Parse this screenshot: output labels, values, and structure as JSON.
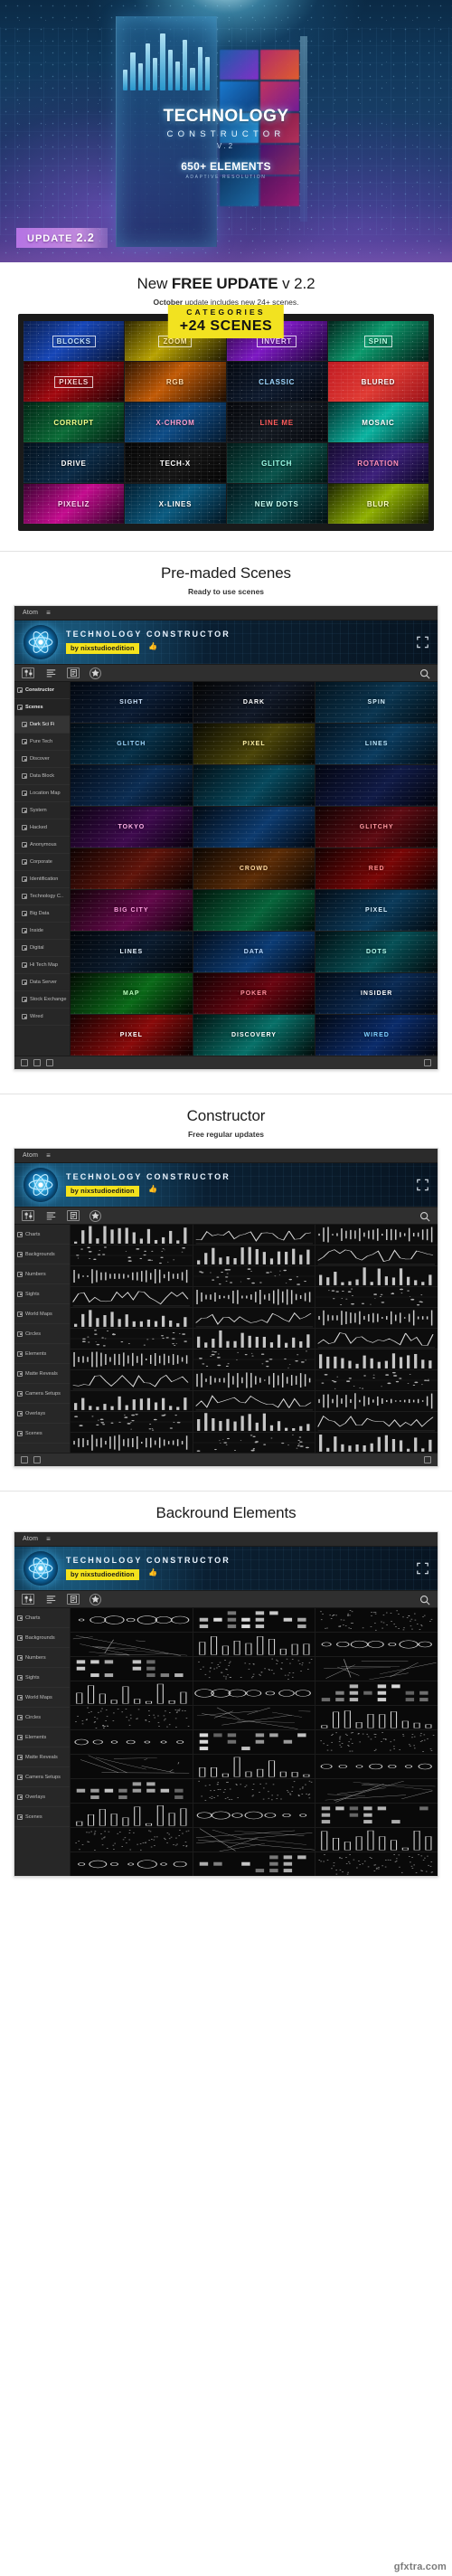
{
  "hero": {
    "title_main": "TECHNOLOGY",
    "title_sub": "CONSTRUCTOR",
    "title_version": "V.2",
    "elements_count": "650+ ELEMENTS",
    "adaptive_note": "ADAPTIVE RESOLUTION",
    "badge_prefix": "UPDATE",
    "badge_version": "2.2"
  },
  "update_section": {
    "heading_pre": "New ",
    "heading_bold": "FREE UPDATE",
    "heading_post": " v 2.2",
    "sub_bold": "October",
    "sub_rest": " update includes new 24+ scenes.",
    "categories_label": "CATEGORIES",
    "scenes_label": "+24 SCENES",
    "cells": [
      {
        "label": "BLOCKS",
        "boxed": true,
        "bg": "linear-gradient(135deg,#0a1c4a,#1646b8 45%,#06102e)",
        "c": "#bfe0ff"
      },
      {
        "label": "ZOOM",
        "boxed": true,
        "bg": "linear-gradient(135deg,#2b2400,#b8a200 45%,#1a1500)",
        "c": "#ffe9a0"
      },
      {
        "label": "INVERT",
        "boxed": true,
        "bg": "linear-gradient(135deg,#2a0740,#7d18c4 45%,#16032a)",
        "c": "#e9c6ff"
      },
      {
        "label": "SPIN",
        "boxed": true,
        "bg": "linear-gradient(135deg,#02241c,#0a9a6c 45%,#021a14)",
        "c": "#b5ffe2"
      },
      {
        "label": "PIXELS",
        "boxed": true,
        "bg": "linear-gradient(135deg,#2a0206,#a3080f 45%,#1a0104)",
        "c": "#ffd2d2"
      },
      {
        "label": "RGB",
        "boxed": false,
        "bg": "linear-gradient(135deg,#2b1300,#c25a05 45%,#1a0b00)",
        "c": "#ffd9a8"
      },
      {
        "label": "CLASSIC",
        "boxed": false,
        "bg": "linear-gradient(135deg,#04080f,#0e1a2e 50%,#03060c)",
        "c": "#9fd8ff"
      },
      {
        "label": "BLURED",
        "boxed": false,
        "bg": "linear-gradient(135deg,#c01a22,#e03a33 50%,#9a1118)",
        "c": "#ffffff"
      },
      {
        "label": "CORRUPT",
        "boxed": false,
        "bg": "linear-gradient(135deg,#012414,#0a6b36 50%,#01190e)",
        "c": "#f4ff8a"
      },
      {
        "label": "X-CHROM",
        "boxed": false,
        "bg": "linear-gradient(135deg,#062039,#0d4b86 50%,#03162a)",
        "c": "#ff9fd0"
      },
      {
        "label": "LINE ME",
        "boxed": false,
        "bg": "linear-gradient(135deg,#05060a,#121820 50%,#04050a)",
        "c": "#ff5c5c"
      },
      {
        "label": "MOSAIC",
        "boxed": false,
        "bg": "linear-gradient(135deg,#01302c,#0ab3a0 50%,#012320)",
        "c": "#ffffff"
      },
      {
        "label": "DRIVE",
        "boxed": false,
        "bg": "linear-gradient(135deg,#03101c,#0a2a46 55%,#020a13)",
        "c": "#ffffff"
      },
      {
        "label": "TECH-X",
        "boxed": false,
        "bg": "linear-gradient(135deg,#050505,#141414 55%,#030303)",
        "c": "#ffffff"
      },
      {
        "label": "GLITCH",
        "boxed": false,
        "bg": "linear-gradient(135deg,#021a18,#08524a 55%,#011210)",
        "c": "#9dffe9"
      },
      {
        "label": "ROTATION",
        "boxed": false,
        "bg": "linear-gradient(135deg,#140a2e,#3b1f7a 55%,#0a0520)",
        "c": "#ff8fb8"
      },
      {
        "label": "PIXELIZ",
        "boxed": false,
        "bg": "linear-gradient(135deg,#3a0230,#c40b8e 50%,#26011f)",
        "c": "#ffd6f2"
      },
      {
        "label": "X-LINES",
        "boxed": false,
        "bg": "linear-gradient(135deg,#021c2e,#0a5a80 50%,#01121e)",
        "c": "#ffffff"
      },
      {
        "label": "NEW DOTS",
        "boxed": false,
        "bg": "linear-gradient(135deg,#02161a,#084a4e 50%,#010d10)",
        "c": "#c9fff4"
      },
      {
        "label": "BLUR",
        "boxed": false,
        "bg": "linear-gradient(135deg,#1a2200,#8fb000 50%,#111700)",
        "c": "#fbffc4"
      }
    ]
  },
  "premade_section": {
    "heading": "Pre-maded Scenes",
    "sub": "Ready to use scenes"
  },
  "constructor_section": {
    "heading": "Constructor",
    "sub": "Free regular updates"
  },
  "background_section": {
    "heading": "Backround Elements",
    "sub": ""
  },
  "app": {
    "menubar": {
      "app_name": "Atom",
      "hamburger": "≡"
    },
    "banner": {
      "title": "TECHNOLOGY CONSTRUCTOR",
      "author_badge": "by nixstudioedition",
      "thumb_icon": "thumbs-up-icon",
      "expand_icon": "expand-icon"
    },
    "toolbar": {
      "sliders_icon": "sliders-icon",
      "list-icon": "list-icon",
      "document_icon": "document-icon",
      "star_icon": "star-icon",
      "search_icon": "search-icon"
    },
    "footer": {
      "icons": [
        "grid-icon",
        "play-icon",
        "pause-icon",
        "fullscreen-icon"
      ]
    }
  },
  "scenes_sidebar": [
    {
      "label": "Constructor",
      "group": true,
      "selected": false,
      "indent": false
    },
    {
      "label": "Scenes",
      "group": true,
      "selected": false,
      "indent": false
    },
    {
      "label": "Dark Sci Fi",
      "group": false,
      "selected": true,
      "indent": true
    },
    {
      "label": "Pure Tech",
      "group": false,
      "selected": false,
      "indent": true
    },
    {
      "label": "Discover",
      "group": false,
      "selected": false,
      "indent": true
    },
    {
      "label": "Data Block",
      "group": false,
      "selected": false,
      "indent": true
    },
    {
      "label": "Location Map",
      "group": false,
      "selected": false,
      "indent": true
    },
    {
      "label": "System",
      "group": false,
      "selected": false,
      "indent": true
    },
    {
      "label": "Hacked",
      "group": false,
      "selected": false,
      "indent": true
    },
    {
      "label": "Anonymous",
      "group": false,
      "selected": false,
      "indent": true
    },
    {
      "label": "Corporate",
      "group": false,
      "selected": false,
      "indent": true
    },
    {
      "label": "Identification",
      "group": false,
      "selected": false,
      "indent": true
    },
    {
      "label": "Technology C..",
      "group": false,
      "selected": false,
      "indent": true
    },
    {
      "label": "Big Data",
      "group": false,
      "selected": false,
      "indent": true
    },
    {
      "label": "Inside",
      "group": false,
      "selected": false,
      "indent": true
    },
    {
      "label": "Digital",
      "group": false,
      "selected": false,
      "indent": true
    },
    {
      "label": "Hi Tech Map",
      "group": false,
      "selected": false,
      "indent": true
    },
    {
      "label": "Data Server",
      "group": false,
      "selected": false,
      "indent": true
    },
    {
      "label": "Stock Exchange",
      "group": false,
      "selected": false,
      "indent": true
    },
    {
      "label": "Wired",
      "group": false,
      "selected": false,
      "indent": true
    }
  ],
  "scenes_tiles": [
    {
      "label": "SIGHT",
      "bg": "linear-gradient(135deg,#02070f,#0a1b33 55%,#01040a)",
      "c": "#cfe6ff"
    },
    {
      "label": "DARK",
      "bg": "linear-gradient(135deg,#040404,#101827 55%,#020203)",
      "c": "#ffffff"
    },
    {
      "label": "SPIN",
      "bg": "linear-gradient(135deg,#03121c,#0a3550 55%,#010a10)",
      "c": "#d5f1ff"
    },
    {
      "label": "GLITCH",
      "bg": "linear-gradient(135deg,#010b14,#063048 55%,#000609)",
      "c": "#9fd9ff"
    },
    {
      "label": "PIXEL",
      "bg": "linear-gradient(135deg,#0a0a02,#4a4408 55%,#060601)",
      "c": "#fff3a8"
    },
    {
      "label": "LINES",
      "bg": "linear-gradient(135deg,#03101b,#0a3b5e 55%,#01080e)",
      "c": "#b9e7ff"
    },
    {
      "label": "",
      "bg": "linear-gradient(135deg,#030a16,#0b2c52 55%,#01050b)",
      "c": "#ffffff"
    },
    {
      "label": "",
      "bg": "linear-gradient(135deg,#020d14,#06485c 55%,#01070b)",
      "c": "#ffffff"
    },
    {
      "label": "",
      "bg": "linear-gradient(135deg,#030510,#101a46 55%,#010208)",
      "c": "#ffffff"
    },
    {
      "label": "TOKYO",
      "bg": "linear-gradient(135deg,#0a0210,#3e0a4e 55%,#06010a)",
      "c": "#ffb3e8"
    },
    {
      "label": "",
      "bg": "linear-gradient(135deg,#020810,#0c3a6e 55%,#01040a)",
      "c": "#ffffff"
    },
    {
      "label": "GLITCHY",
      "bg": "linear-gradient(135deg,#100202,#5e0a12 55%,#090101)",
      "c": "#ff9aa2"
    },
    {
      "label": "",
      "bg": "linear-gradient(135deg,#0d0202,#60140a 55%,#070101)",
      "c": "#ffffff"
    },
    {
      "label": "CROWD",
      "bg": "linear-gradient(135deg,#0a0502,#5c2c06 55%,#060301)",
      "c": "#ffd9a0"
    },
    {
      "label": "RED",
      "bg": "linear-gradient(135deg,#120101,#7a0606 55%,#0a0101)",
      "c": "#ff8d8d"
    },
    {
      "label": "BIG CITY",
      "bg": "linear-gradient(135deg,#100206,#63084a 55%,#080103)",
      "c": "#ff9fe0"
    },
    {
      "label": "",
      "bg": "linear-gradient(135deg,#01120a,#06643a 55%,#010a06)",
      "c": "#ffffff"
    },
    {
      "label": "PIXEL",
      "bg": "linear-gradient(135deg,#030b14,#0a3a5a 55%,#01060b)",
      "c": "#d8f0ff"
    },
    {
      "label": "LINES",
      "bg": "linear-gradient(135deg,#020509,#0a1b2e 55%,#010305)",
      "c": "#e6f3ff"
    },
    {
      "label": "DATA",
      "bg": "linear-gradient(135deg,#020a16,#0b3b74 55%,#01050c)",
      "c": "#bcdcff"
    },
    {
      "label": "DOTS",
      "bg": "linear-gradient(135deg,#010d10,#065056 55%,#01070a)",
      "c": "#b8fff0"
    },
    {
      "label": "MAP",
      "bg": "linear-gradient(135deg,#020a02,#0a6a18 55%,#010601)",
      "c": "#b9ffbb"
    },
    {
      "label": "POKER",
      "bg": "linear-gradient(135deg,#0e0102,#6a0410 55%,#080101)",
      "c": "#ff8f9c"
    },
    {
      "label": "INSIDER",
      "bg": "linear-gradient(135deg,#020810,#0a2a54 55%,#01040a)",
      "c": "#ffffff"
    },
    {
      "label": "PIXEL",
      "bg": "linear-gradient(135deg,#120101,#8a0a0a 55%,#0a0101)",
      "c": "#ffffff"
    },
    {
      "label": "DISCOVERY",
      "bg": "linear-gradient(135deg,#01100e,#077068 55%,#010a09)",
      "c": "#ffffff"
    },
    {
      "label": "WIRED",
      "bg": "linear-gradient(135deg,#020710,#0a2b6a 55%,#01030a)",
      "c": "#7fd0ff"
    }
  ],
  "constructor_sidebar": [
    {
      "label": "Charts"
    },
    {
      "label": "Backgrounds"
    },
    {
      "label": "Numbers"
    },
    {
      "label": "Sights"
    },
    {
      "label": "World Maps"
    },
    {
      "label": "Circles"
    },
    {
      "label": "Elements"
    },
    {
      "label": "Matte Reveals"
    },
    {
      "label": "Camera Setups"
    },
    {
      "label": "Overlays"
    },
    {
      "label": "Scenes"
    }
  ],
  "background_sidebar": [
    {
      "label": "Charts"
    },
    {
      "label": "Backgrounds"
    },
    {
      "label": "Numbers"
    },
    {
      "label": "Sights"
    },
    {
      "label": "World Maps"
    },
    {
      "label": "Circles"
    },
    {
      "label": "Elements"
    },
    {
      "label": "Matte Reveals"
    },
    {
      "label": "Camera Setups"
    },
    {
      "label": "Overlays"
    },
    {
      "label": "Scenes"
    }
  ],
  "watermark": "gfxtra.com",
  "colors": {
    "accent_yellow": "#f2e220",
    "badge_purple": "#be78eb",
    "app_dark": "#232323"
  }
}
